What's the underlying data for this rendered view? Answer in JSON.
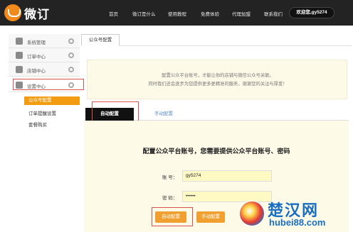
{
  "brand": {
    "name": "微订",
    "accent": "#f08a1c"
  },
  "nav": {
    "items": [
      "首页",
      "微订是什么",
      "使用教程",
      "免费体验",
      "代理加盟",
      "联系我们"
    ],
    "user": "欢迎您,gy5274"
  },
  "sidebar": {
    "items": [
      {
        "label": "系统管理",
        "icon": "system-icon"
      },
      {
        "label": "订单中心",
        "icon": "order-icon"
      },
      {
        "label": "店铺中心",
        "icon": "shop-icon"
      },
      {
        "label": "设置中心",
        "icon": "settings-icon"
      }
    ],
    "sub_items": [
      "公众号配置",
      "订单提醒设置",
      "套餐购买"
    ],
    "active_sub": "公众号配置"
  },
  "main": {
    "tab": "公众号配置",
    "notice": [
      "配置公众平台账号，才能让你的店铺与微信公众号关联。",
      "同时我们还会逐步为您提供更多更精准的服务，谢谢您的关注与厚爱！"
    ],
    "mode_tabs": [
      "自动配置",
      "手动配置"
    ],
    "active_mode": "自动配置",
    "form": {
      "heading": "配置公众平台账号，您需要提供公众平台账号、密码",
      "account_label": "账 号：",
      "account_value": "gy5274",
      "password_label": "密 码：",
      "password_value": "••••••",
      "auto_button": "自动配置",
      "manual_button": "手动配置"
    }
  },
  "watermark": {
    "text": "楚汉网",
    "url": "hubei88.com"
  }
}
